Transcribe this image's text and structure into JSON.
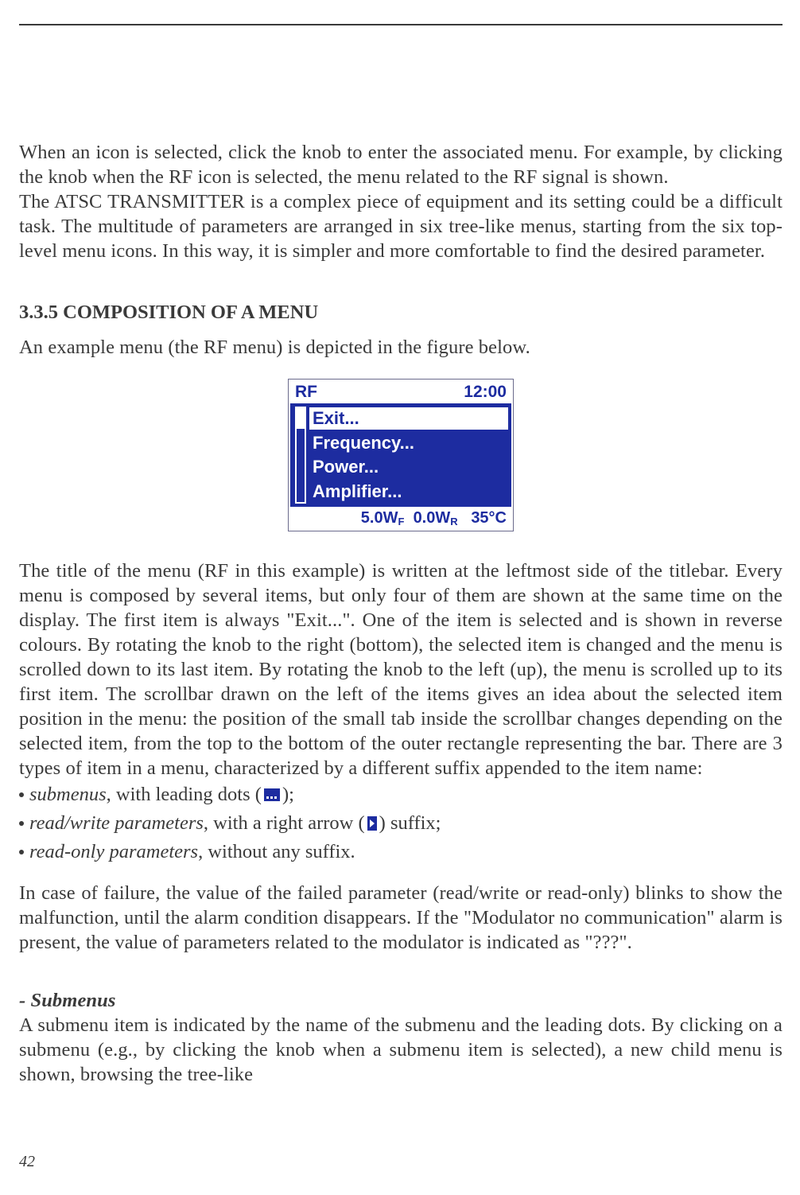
{
  "para1": "When an icon is selected, click the knob to enter the associated menu. For example, by clicking the knob when the RF icon is selected, the menu related to the RF signal is shown.",
  "para2": "The ATSC TRANSMITTER is a complex piece of equipment and its setting could be a difficult task. The multitude of parameters are arranged in six tree-like menus, starting from the six top-level menu icons. In this way, it is simpler and more comfortable to find the desired parameter.",
  "heading335": "3.3.5 COMPOSITION OF A MENU",
  "para3": "An example menu (the RF menu) is depicted in the figure below.",
  "lcd": {
    "title": "RF",
    "clock": "12:00",
    "items": [
      "Exit...",
      "Frequency...",
      "Power...",
      "Amplifier..."
    ],
    "selected_index": 0,
    "status_wf": "5.0W",
    "status_wf_sub": "F",
    "status_wr": "0.0W",
    "status_wr_sub": "R",
    "status_temp": "35°C"
  },
  "para4": "The title of the menu (RF in this example) is written at the leftmost side of the titlebar. Every menu is composed by several items, but only four of them are shown at the same time on the display. The first item is always \"Exit...\". One of the item is selected and is shown in reverse colours. By rotating the knob to the right (bottom), the selected item is changed and the menu is scrolled down to its last item. By rotating the knob to the left (up), the menu is scrolled up to its first item. The scrollbar drawn on the left of the items gives an idea about the selected item position in the menu: the position of the small tab inside the scrollbar changes depending on the selected item, from the top to the bottom of the outer rectangle representing the bar. There are 3 types of item in a menu, characterized by a different suffix appended to the item name:",
  "bullets": {
    "b1_pre": "submenus",
    "b1_post": ", with leading dots (",
    "b1_tail": ");",
    "b2_pre": "read/write parameters",
    "b2_post": ", with a right arrow (",
    "b2_tail": ") suffix;",
    "b3_pre": "read-only parameters",
    "b3_post": ", without any suffix."
  },
  "para5": "In case of failure, the value of the failed parameter (read/write or read-only) blinks to show the malfunction, until the alarm condition disappears. If the \"Modulator no communication\" alarm is present, the value of parameters related to the modulator is indicated as \"???\".",
  "subheading": "- Submenus",
  "para6": "A submenu item is indicated by the name of the submenu and the leading dots. By clicking on a submenu (e.g., by clicking the knob when a submenu item is selected), a new child menu is shown, browsing the tree-like",
  "page_number": "42"
}
